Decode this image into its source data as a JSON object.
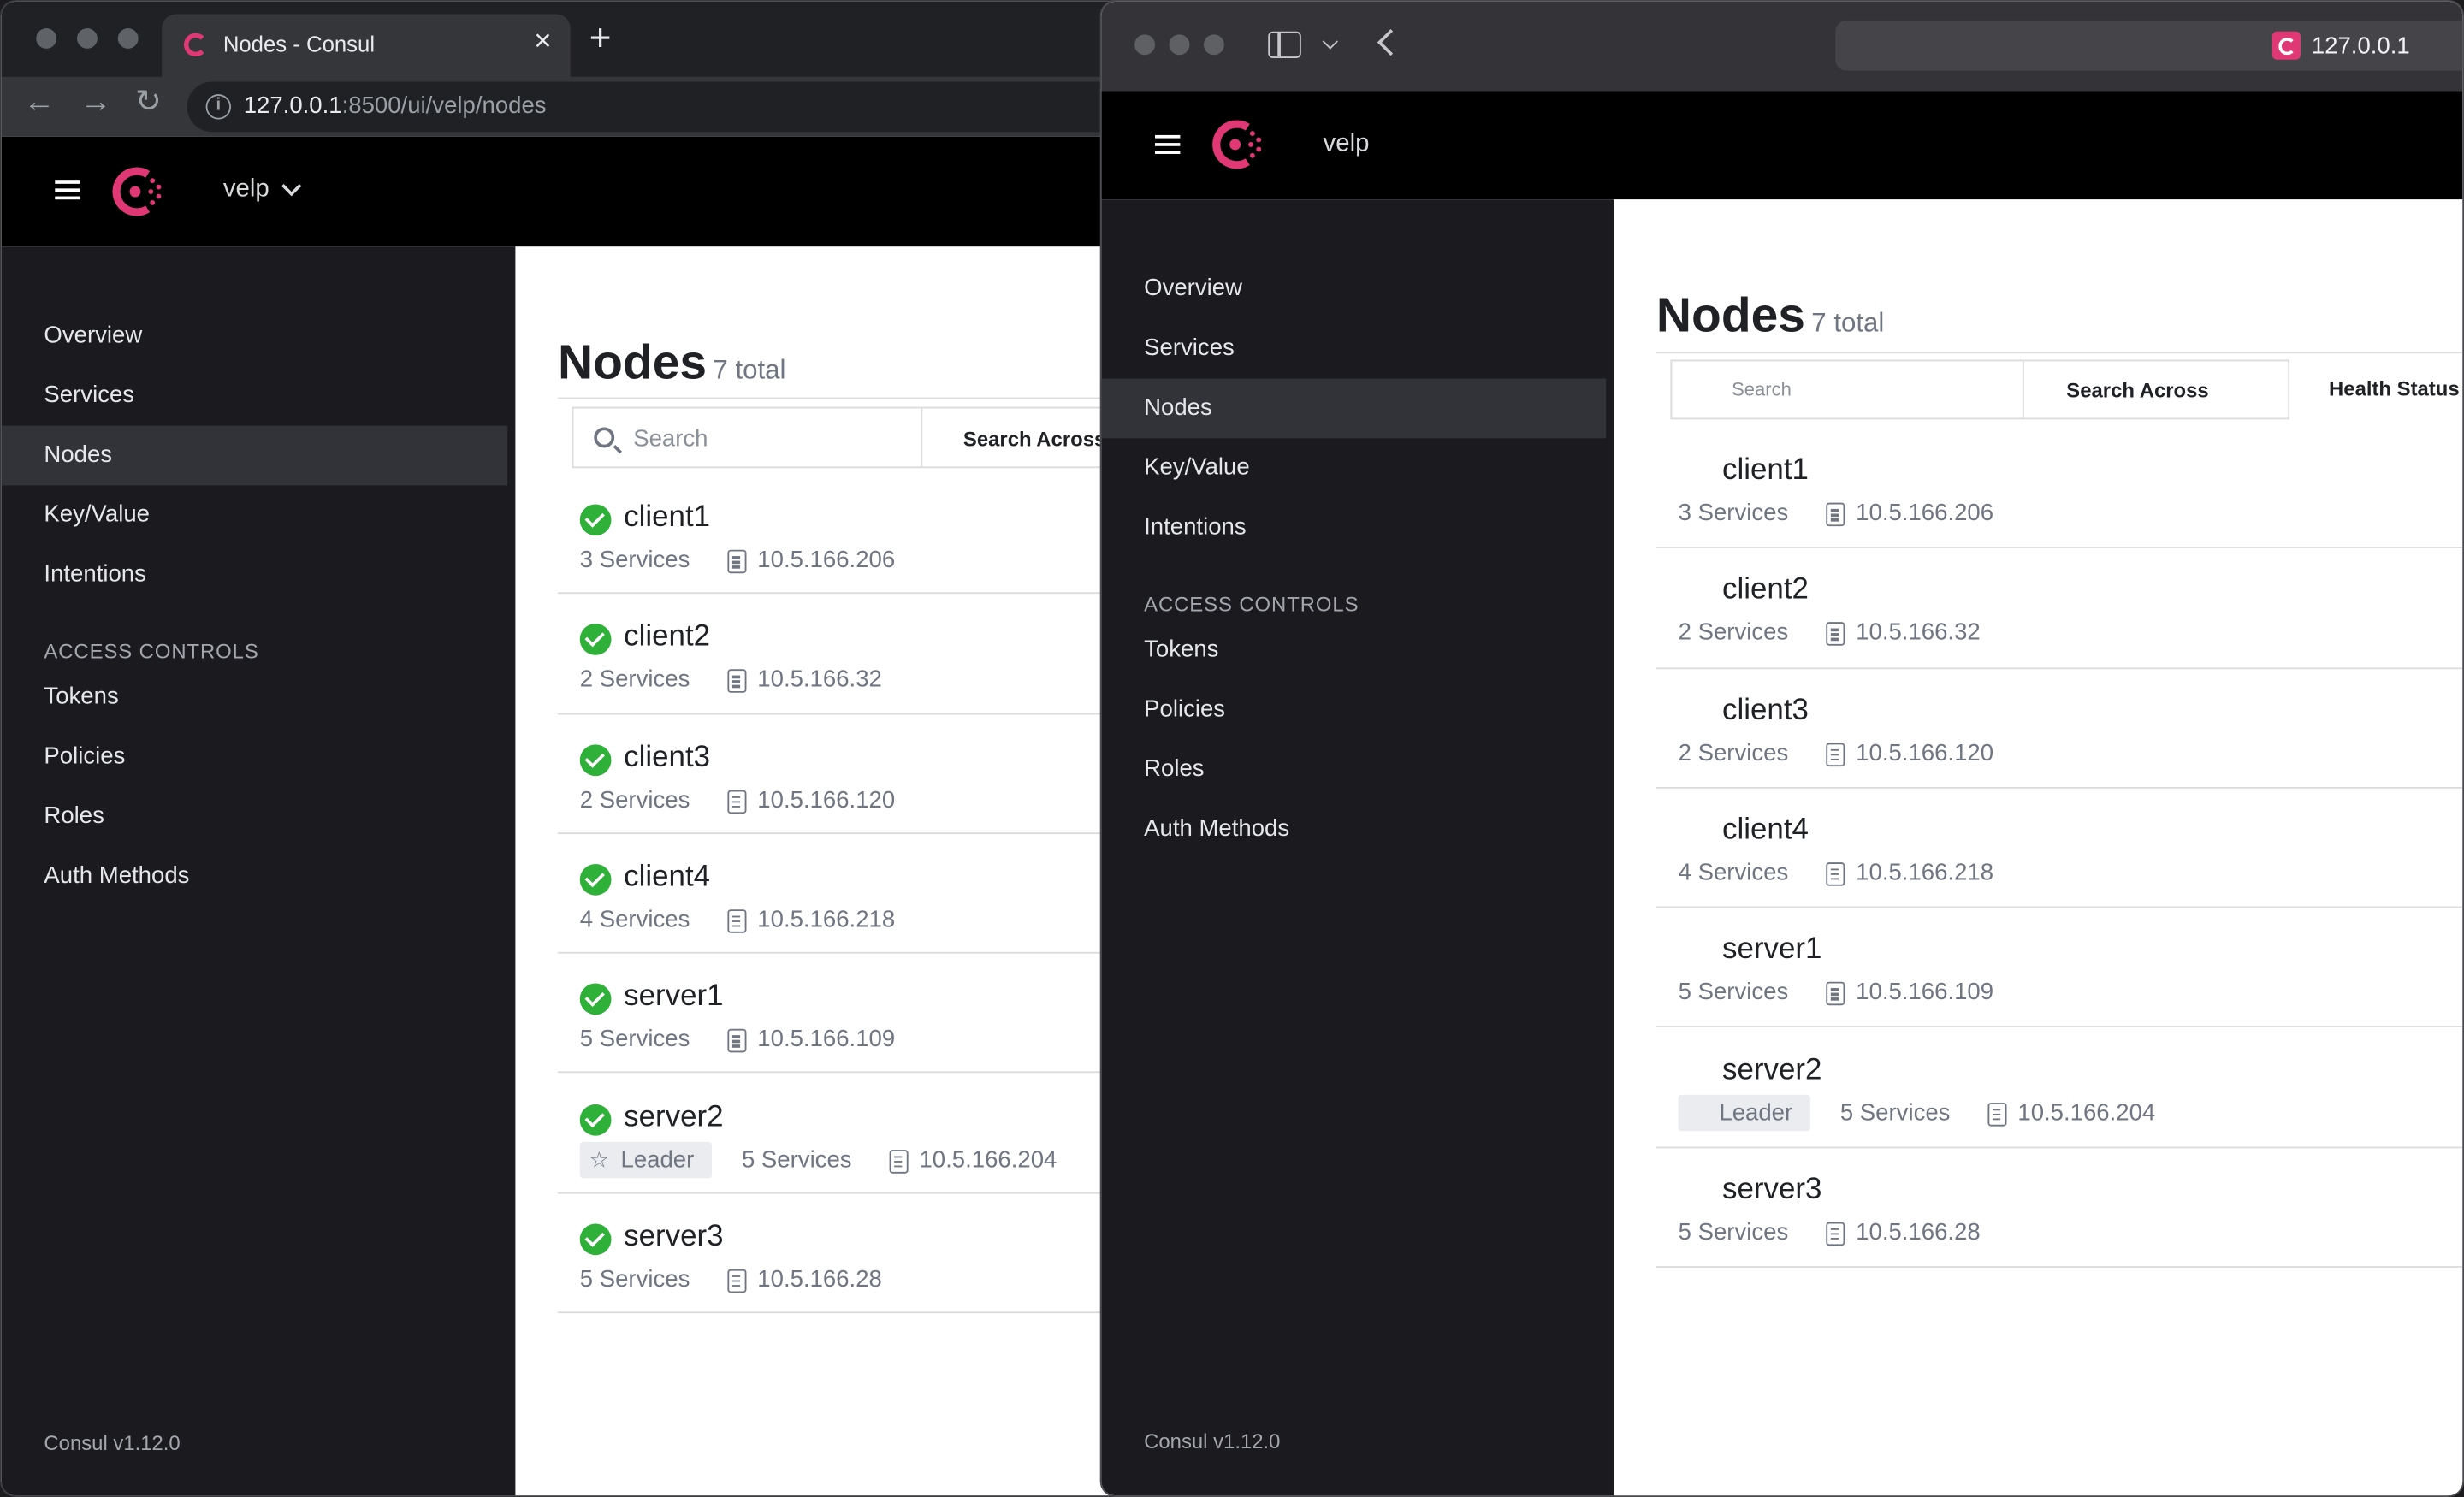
{
  "window_a": {
    "tab_title": "Nodes - Consul",
    "url_host": "127.0.0.1",
    "url_rest": ":8500/ui/velp/nodes",
    "datacenter": "velp"
  },
  "window_b": {
    "address": "127.0.0.1",
    "datacenter": "velp"
  },
  "nav": {
    "items": [
      "Overview",
      "Services",
      "Nodes",
      "Key/Value",
      "Intentions"
    ],
    "active": "Nodes",
    "access_heading": "ACCESS CONTROLS",
    "access_items": [
      "Tokens",
      "Policies",
      "Roles",
      "Auth Methods"
    ],
    "version": "Consul v1.12.0"
  },
  "page": {
    "title": "Nodes",
    "total": "7 total",
    "search_placeholder": "Search",
    "search_across": "Search Across",
    "health_status": "Health Status"
  },
  "nodes": [
    {
      "name": "client1",
      "services": "3 Services",
      "address": "10.5.166.206",
      "leader": false,
      "status": "passing"
    },
    {
      "name": "client2",
      "services": "2 Services",
      "address": "10.5.166.32",
      "leader": false,
      "status": "passing"
    },
    {
      "name": "client3",
      "services": "2 Services",
      "address": "10.5.166.120",
      "leader": false,
      "status": "passing"
    },
    {
      "name": "client4",
      "services": "4 Services",
      "address": "10.5.166.218",
      "leader": false,
      "status": "passing"
    },
    {
      "name": "server1",
      "services": "5 Services",
      "address": "10.5.166.109",
      "leader": false,
      "status": "passing"
    },
    {
      "name": "server2",
      "services": "5 Services",
      "address": "10.5.166.204",
      "leader": true,
      "status": "passing"
    },
    {
      "name": "server3",
      "services": "5 Services",
      "address": "10.5.166.28",
      "leader": false,
      "status": "passing"
    }
  ],
  "leader_label": "Leader",
  "colors": {
    "brand": "#e03875",
    "passing": "#2eb039",
    "sidebar": "#1b1b1f",
    "topbar": "#000000"
  }
}
